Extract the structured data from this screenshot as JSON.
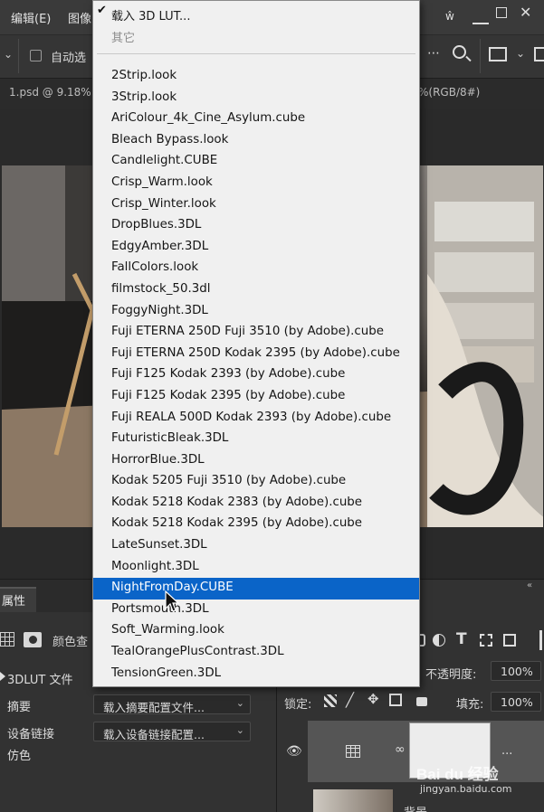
{
  "menubar": {
    "items": [
      "编辑(E)",
      "图像"
    ],
    "right_glyph": "ŵ"
  },
  "options_bar": {
    "auto_select_label": "自动选"
  },
  "tabs": {
    "left": "1.psd @ 9.18%",
    "right": "%(RGB/8#)"
  },
  "lut_menu": {
    "load_label": "载入 3D LUT...",
    "other_label": "其它",
    "checked_icon": "check-icon",
    "items": [
      "2Strip.look",
      "3Strip.look",
      "AriColour_4k_Cine_Asylum.cube",
      "Bleach Bypass.look",
      "Candlelight.CUBE",
      "Crisp_Warm.look",
      "Crisp_Winter.look",
      "DropBlues.3DL",
      "EdgyAmber.3DL",
      "FallColors.look",
      "filmstock_50.3dl",
      "FoggyNight.3DL",
      "Fuji ETERNA 250D Fuji 3510 (by Adobe).cube",
      "Fuji ETERNA 250D Kodak 2395 (by Adobe).cube",
      "Fuji F125 Kodak 2393 (by Adobe).cube",
      "Fuji F125 Kodak 2395 (by Adobe).cube",
      "Fuji REALA 500D Kodak 2393 (by Adobe).cube",
      "FuturisticBleak.3DL",
      "HorrorBlue.3DL",
      "Kodak 5205 Fuji 3510 (by Adobe).cube",
      "Kodak 5218 Kodak 2383 (by Adobe).cube",
      "Kodak 5218 Kodak 2395 (by Adobe).cube",
      "LateSunset.3DL",
      "Moonlight.3DL",
      "NightFromDay.CUBE",
      "Portsmouth.3DL",
      "Soft_Warming.look",
      "TealOrangePlusContrast.3DL",
      "TensionGreen.3DL"
    ],
    "selected_item": "NightFromDay.CUBE",
    "highlight_color": "#0a64c8"
  },
  "properties_panel": {
    "title": "属性",
    "adjustment_label": "颜色查",
    "rows": [
      {
        "label": "3DLUT 文件",
        "value": ""
      },
      {
        "label": "摘要",
        "value": "载入摘要配置文件..."
      },
      {
        "label": "设备链接",
        "value": "载入设备链接配置..."
      },
      {
        "label": "仿色",
        "value": ""
      }
    ]
  },
  "layers_panel": {
    "opacity_label": "不透明度:",
    "opacity_value": "100%",
    "lock_label": "锁定:",
    "fill_label": "填充:",
    "fill_value": "100%",
    "layer_name": "背景",
    "more_glyph": "..."
  },
  "watermark": {
    "logo": "Bai du 经验",
    "url": "jingyan.baidu.com"
  }
}
